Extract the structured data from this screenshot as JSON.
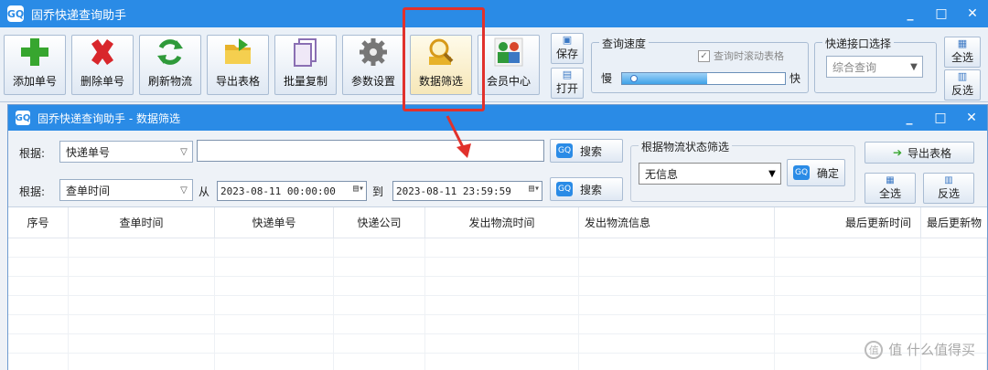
{
  "app": {
    "title": "固乔快递查询助手",
    "logo": "GQ"
  },
  "window_controls": {
    "minimize": "_",
    "maximize": "□",
    "close": "✕"
  },
  "toolbar": {
    "buttons": [
      {
        "label": "添加单号",
        "icon": "plus-icon",
        "color": "#37a62f"
      },
      {
        "label": "删除单号",
        "icon": "delete-icon",
        "color": "#d8262b"
      },
      {
        "label": "刷新物流",
        "icon": "refresh-icon",
        "color": "#2f9a3a"
      },
      {
        "label": "导出表格",
        "icon": "folder-export-icon",
        "color": "#e7b22a"
      },
      {
        "label": "批量复制",
        "icon": "copy-icon",
        "color": "#8a6fb3"
      },
      {
        "label": "参数设置",
        "icon": "gear-icon",
        "color": "#666666"
      },
      {
        "label": "数据筛选",
        "icon": "magnifier-icon",
        "color": "#e7b22a"
      },
      {
        "label": "会员中心",
        "icon": "users-icon",
        "color": "#d8462b"
      }
    ],
    "save_label": "保存",
    "open_label": "打开",
    "speed": {
      "title": "查询速度",
      "scroll_checkbox": "查询时滚动表格",
      "slow": "慢",
      "fast": "快",
      "level": 0.05
    },
    "api": {
      "title": "快递接口选择",
      "selected": "综合查询"
    },
    "select_all": "全选",
    "invert": "反选"
  },
  "child": {
    "title": "固乔快递查询助手 - 数据筛选",
    "filter": {
      "by_label": "根据:",
      "field1": "快递单号",
      "keyword": "",
      "field2": "查单时间",
      "from_label": "从",
      "to_label": "到",
      "from": "2023-08-11 00:00:00",
      "to": "2023-08-11 23:59:59",
      "search_label": "搜索",
      "status_group": "根据物流状态筛选",
      "status_selected": "无信息",
      "confirm_label": "确定",
      "export_label": "导出表格",
      "select_all": "全选",
      "invert": "反选"
    },
    "columns": [
      "序号",
      "查单时间",
      "快递单号",
      "快递公司",
      "发出物流时间",
      "发出物流信息",
      "最后更新时间",
      "最后更新物"
    ]
  },
  "watermark": "值 什么值得买"
}
